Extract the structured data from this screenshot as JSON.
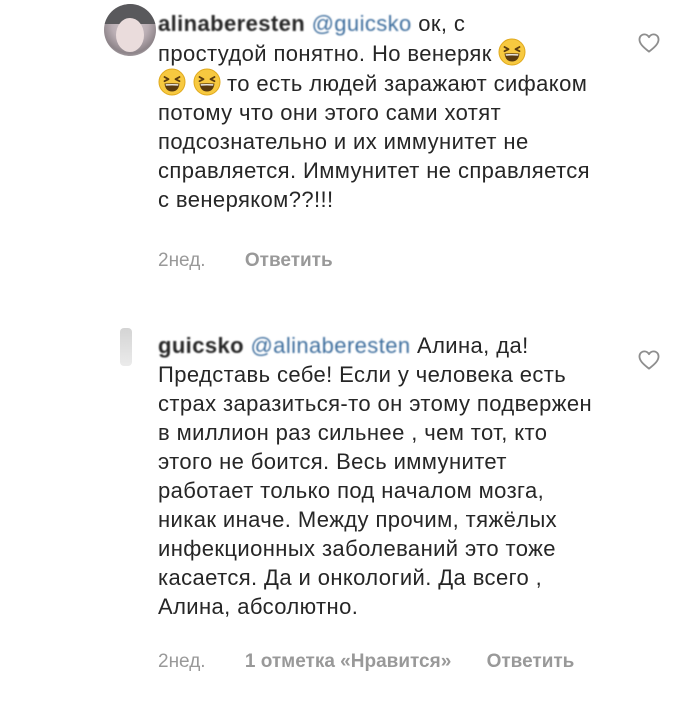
{
  "comments": [
    {
      "username": "alinaberesten",
      "mention": "@guicsko",
      "text_line1": "ок, с",
      "text_line2": "простудой понятно. Но венеряк",
      "text_line3": "то есть людей заражают",
      "text_rest": "сифаком потому что они этого сами хотят подсознательно и их иммунитет не справляется. Иммунитет не справляется с венеряком??!!!",
      "emoji": "grinning-squinting-face",
      "time": "2нед.",
      "reply_label": "Ответить"
    },
    {
      "username": "guicsko",
      "mention": "@alinaberesten",
      "text": "Алина, да! Представь себе! Если у человека есть страх заразиться-то он этому подвержен в миллион раз сильнее , чем тот, кто этого не боится. Весь иммунитет работает только под началом мозга, никак иначе. Между прочим, тяжёлых инфекционных заболеваний это тоже касается. Да и онкологий. Да всего , Алина, абсолютно.",
      "time": "2нед.",
      "likes_label": "1 отметка «Нравится»",
      "reply_label": "Ответить"
    }
  ],
  "icons": {
    "like": "heart-outline-icon"
  },
  "colors": {
    "text": "#262626",
    "meta": "#999999",
    "mention": "#3f6f9e",
    "emoji_face": "#f7c940"
  }
}
